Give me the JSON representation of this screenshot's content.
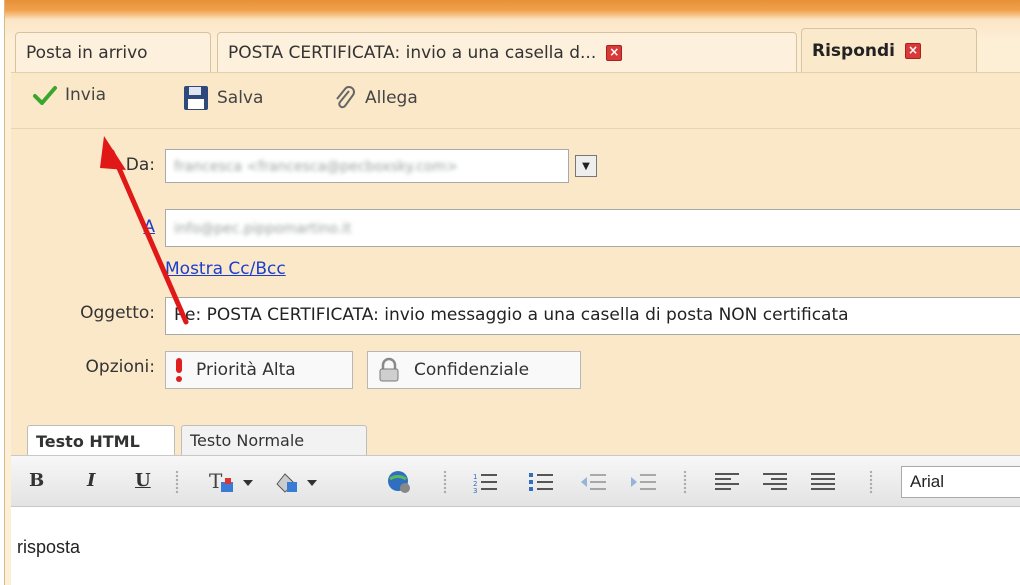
{
  "tabs": [
    {
      "label": "Posta in arrivo"
    },
    {
      "label": "POSTA CERTIFICATA: invio a una casella d..."
    },
    {
      "label": "Rispondi"
    }
  ],
  "toolbar": {
    "send_label": "Invia",
    "save_label": "Salva",
    "attach_label": "Allega"
  },
  "form": {
    "from_label": "Da:",
    "from_value": "francesca <francesca@pecboxsky.com>",
    "to_label": "A",
    "to_value": "info@pec.pippomartino.it",
    "show_cc_bcc": "Mostra Cc/Bcc",
    "subject_label": "Oggetto:",
    "subject_value": "Re: POSTA CERTIFICATA: invio messaggio a una casella di posta NON certificata",
    "options_label": "Opzioni:",
    "priority_label": "Priorità Alta",
    "confidential_label": "Confidenziale"
  },
  "editor": {
    "tabs": [
      {
        "label": "Testo HTML"
      },
      {
        "label": "Testo Normale"
      }
    ],
    "bold": "B",
    "italic": "I",
    "underline": "U",
    "font": "Arial",
    "body": "risposta"
  },
  "colors": {
    "accent_arrow": "#e01818",
    "link": "#1a3fd0",
    "panel": "#fbe8c9"
  }
}
